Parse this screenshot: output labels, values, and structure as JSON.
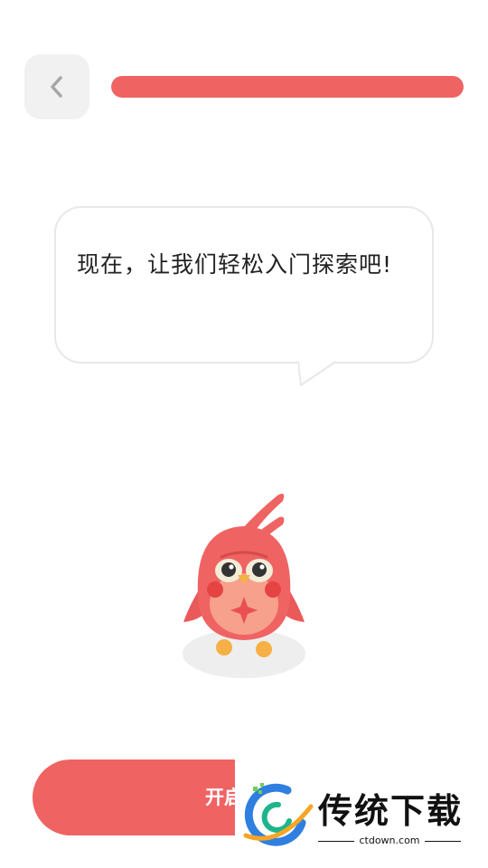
{
  "nav": {
    "back_icon": "chevron-left-icon"
  },
  "progress": {
    "fraction": 1.0,
    "color": "#f06363"
  },
  "speech_bubble": {
    "text": "现在，让我们轻松入门探索吧!"
  },
  "mascot": {
    "icon": "red-bird-mascot"
  },
  "cta": {
    "label": "开启阅",
    "color": "#f06363"
  },
  "watermark": {
    "title": "传统下载",
    "domain": "ctdown.com"
  }
}
